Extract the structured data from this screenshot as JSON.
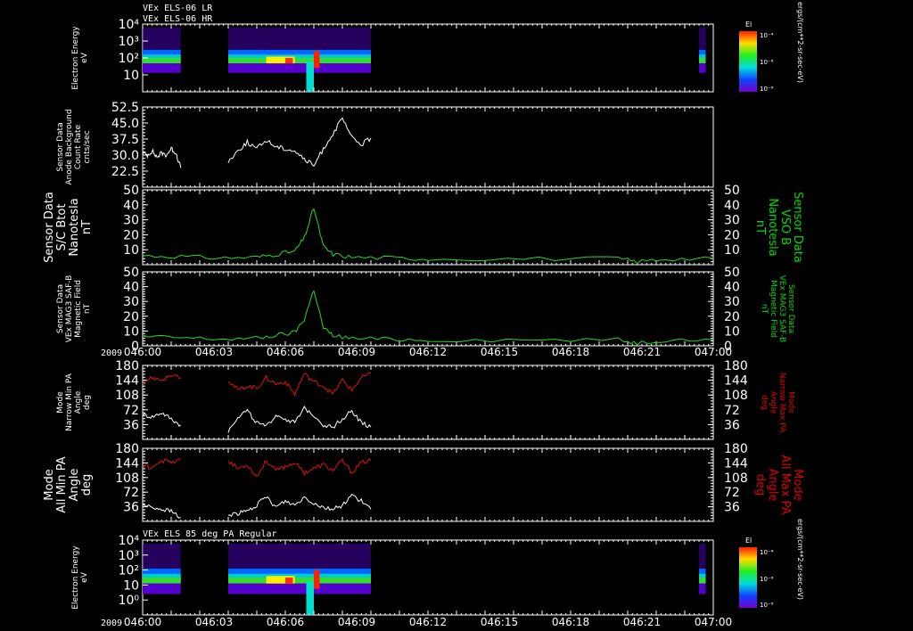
{
  "header": {
    "line1": "VEx ELS-06 LR",
    "line2": "VEx ELS-06 HR"
  },
  "footer_label": "VEx ELS 85 deg PA Regular",
  "year_label": "2009",
  "time_ticks": [
    "046:00",
    "046:03",
    "046:06",
    "046:09",
    "046:12",
    "046:15",
    "046:18",
    "046:21",
    "047:00"
  ],
  "colorbar": {
    "title": "El",
    "units": "ergs/(cm**2-sr-sec-eV)",
    "labels": [
      "10⁻⁴",
      "10⁻⁶",
      "10⁻⁸"
    ]
  },
  "colors": {
    "white": "#ffffff",
    "green": "#22dd22",
    "red": "#dd1111",
    "label_green": "#00dd00",
    "label_red": "#dd0000"
  },
  "chart_data": [
    {
      "type": "heatmap",
      "title": "",
      "ylabel": [
        "Electron Energy",
        "eV"
      ],
      "yticks": [
        "10⁴",
        "10³",
        "10²",
        "10"
      ],
      "ylim_log": [
        0,
        4
      ],
      "data_segments_minutes": [
        [
          0,
          4
        ],
        [
          9,
          24
        ],
        [
          58.5,
          59.2
        ]
      ]
    },
    {
      "type": "line",
      "ylabel": [
        "Sensor Data",
        "Anode Background",
        "Count Rate",
        "cnts/sec"
      ],
      "yticks": [
        "52.5",
        "45.0",
        "37.5",
        "30.0",
        "22.5"
      ],
      "ylim": [
        15,
        52.5
      ],
      "series": [
        {
          "color": "white",
          "segments": [
            {
              "x": [
                0,
                0.5,
                1,
                1.5,
                2,
                2.5,
                3,
                3.5,
                4
              ],
              "y": [
                31,
                30,
                32,
                29,
                31,
                30,
                33,
                31,
                24
              ]
            },
            {
              "x": [
                9,
                10,
                11,
                12,
                13,
                14,
                15,
                16,
                17,
                18,
                19,
                20,
                21,
                22,
                23,
                24
              ],
              "y": [
                27,
                32,
                36,
                33,
                37,
                34,
                33,
                32,
                28,
                25,
                33,
                40,
                47,
                38,
                35,
                38
              ]
            }
          ]
        }
      ]
    },
    {
      "type": "line",
      "ylabel": [
        "Sensor Data",
        "S/C Btot",
        "Nanotesla",
        "nT"
      ],
      "ylabel_right": [
        "Sensor Data",
        "VSO B",
        "Nanotesla",
        "nT"
      ],
      "yticks": [
        "50",
        "40",
        "30",
        "20",
        "10"
      ],
      "ylim": [
        0,
        50
      ],
      "series": [
        {
          "color": "green",
          "x": [
            0,
            4,
            8,
            12,
            14,
            16,
            17,
            18,
            19,
            20,
            22,
            26,
            30,
            40,
            50,
            52,
            55,
            60
          ],
          "y": [
            6,
            5.5,
            4.5,
            5,
            7,
            9,
            18,
            38,
            12,
            7,
            5,
            4.5,
            4,
            4,
            4,
            2,
            4,
            4
          ]
        }
      ]
    },
    {
      "type": "line",
      "ylabel": [
        "Sensor Data",
        "VEx MAG3 SAF-B",
        "Magnetic Field",
        "nT"
      ],
      "ylabel_right": [
        "Sensor Data",
        "VEx MAG3 SAF-B",
        "Magnetic Field",
        "nT"
      ],
      "yticks": [
        "50",
        "40",
        "30",
        "20",
        "10",
        "0"
      ],
      "ylim": [
        0,
        50
      ],
      "series": [
        {
          "color": "green",
          "x": [
            0,
            4,
            8,
            12,
            14,
            16,
            17,
            18,
            19,
            20,
            22,
            26,
            30,
            40,
            50,
            52,
            55,
            60
          ],
          "y": [
            6,
            5.5,
            4.5,
            5,
            7,
            9,
            18,
            38,
            12,
            7,
            5,
            4.5,
            4,
            4,
            4,
            2,
            4,
            4
          ]
        }
      ]
    },
    {
      "type": "line",
      "ylabel": [
        "Mode",
        "Narrow Min PA",
        "Angle",
        "deg"
      ],
      "ylabel_right": [
        "Mode",
        "Narrow Max PA",
        "Angle",
        "deg"
      ],
      "yticks": [
        "180",
        "144",
        "108",
        "72",
        "36"
      ],
      "ylim": [
        0,
        180
      ],
      "series": [
        {
          "name": "Max PA",
          "color": "red",
          "segments": [
            {
              "x": [
                0,
                1,
                2,
                3,
                4
              ],
              "y": [
                140,
                150,
                145,
                155,
                150
              ]
            },
            {
              "x": [
                9,
                10,
                11,
                12,
                13,
                14,
                15,
                16,
                17,
                18,
                19,
                20,
                21,
                22,
                23,
                24
              ],
              "y": [
                145,
                120,
                130,
                125,
                150,
                135,
                140,
                110,
                160,
                140,
                130,
                110,
                145,
                120,
                150,
                160
              ]
            }
          ]
        },
        {
          "name": "Min PA",
          "color": "white",
          "segments": [
            {
              "x": [
                0,
                1,
                2,
                3,
                4
              ],
              "y": [
                60,
                55,
                65,
                50,
                35
              ]
            },
            {
              "x": [
                9,
                10,
                11,
                12,
                13,
                14,
                15,
                16,
                17,
                18,
                19,
                20,
                21,
                22,
                23,
                24
              ],
              "y": [
                20,
                55,
                70,
                40,
                30,
                60,
                50,
                40,
                75,
                60,
                35,
                30,
                50,
                70,
                40,
                30
              ]
            }
          ]
        }
      ]
    },
    {
      "type": "line",
      "ylabel": [
        "Mode",
        "All Min PA",
        "Angle",
        "deg"
      ],
      "ylabel_right": [
        "Mode",
        "All Max PA",
        "Angle",
        "deg"
      ],
      "yticks": [
        "180",
        "144",
        "108",
        "72",
        "36"
      ],
      "ylim": [
        0,
        180
      ],
      "series": [
        {
          "name": "Max PA",
          "color": "red",
          "segments": [
            {
              "x": [
                0,
                1,
                2,
                3,
                4
              ],
              "y": [
                140,
                130,
                150,
                145,
                155
              ]
            },
            {
              "x": [
                9,
                10,
                11,
                12,
                13,
                14,
                15,
                16,
                17,
                18,
                19,
                20,
                21,
                22,
                23,
                24
              ],
              "y": [
                150,
                130,
                140,
                110,
                150,
                125,
                135,
                145,
                120,
                130,
                140,
                125,
                150,
                120,
                145,
                150
              ]
            }
          ]
        },
        {
          "name": "Min PA",
          "color": "white",
          "segments": [
            {
              "x": [
                0,
                1,
                2,
                3,
                4
              ],
              "y": [
                40,
                35,
                30,
                25,
                10
              ]
            },
            {
              "x": [
                9,
                10,
                11,
                12,
                13,
                14,
                15,
                16,
                17,
                18,
                19,
                20,
                21,
                22,
                23,
                24
              ],
              "y": [
                15,
                20,
                25,
                40,
                60,
                35,
                50,
                40,
                60,
                45,
                35,
                30,
                40,
                65,
                50,
                30
              ]
            }
          ]
        }
      ]
    },
    {
      "type": "heatmap",
      "ylabel": [
        "Electron Energy",
        "eV"
      ],
      "yticks": [
        "10⁴",
        "10³",
        "10²",
        "10",
        "10⁰"
      ],
      "ylim_log": [
        -1,
        4
      ],
      "data_segments_minutes": [
        [
          0,
          4
        ],
        [
          9,
          24
        ],
        [
          58.5,
          59.2
        ]
      ]
    }
  ]
}
